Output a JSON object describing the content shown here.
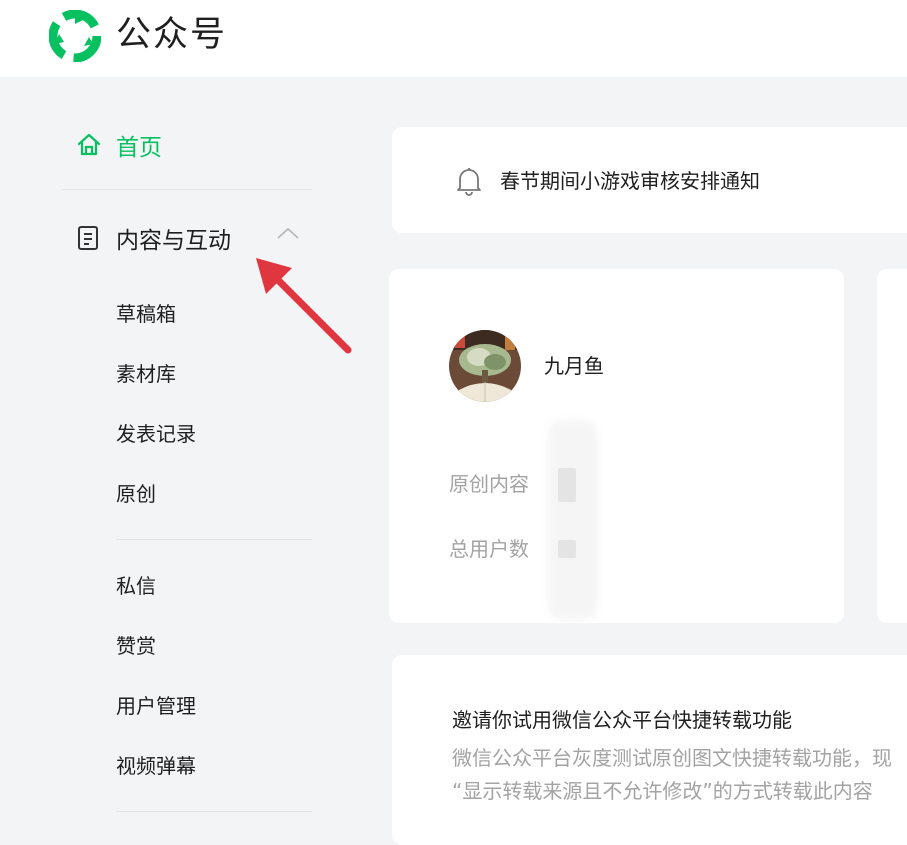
{
  "header": {
    "brand": "公众号",
    "logo_icon": "wechat-official-accounts-logo",
    "accent_color": "#07c160"
  },
  "sidebar": {
    "home": {
      "label": "首页",
      "icon": "home-icon"
    },
    "content_interaction": {
      "label": "内容与互动",
      "icon": "document-icon",
      "expanded": true
    },
    "sub_items": [
      {
        "label": "草稿箱"
      },
      {
        "label": "素材库"
      },
      {
        "label": "发表记录"
      },
      {
        "label": "原创"
      },
      {
        "label": "私信"
      },
      {
        "label": "赞赏"
      },
      {
        "label": "用户管理"
      },
      {
        "label": "视频弹幕"
      }
    ]
  },
  "notice": {
    "text": "春节期间小游戏审核安排通知",
    "icon": "bell-icon"
  },
  "account": {
    "name": "九月鱼",
    "stats": [
      {
        "label": "原创内容"
      },
      {
        "label": "总用户数"
      }
    ]
  },
  "promo": {
    "title": "邀请你试用微信公众平台快捷转载功能",
    "lines": [
      "微信公众平台灰度测试原创图文快捷转载功能，现",
      "“显示转载来源且不允许修改”的方式转载此内容"
    ]
  },
  "annotation": {
    "arrow_color": "#e0363f"
  }
}
